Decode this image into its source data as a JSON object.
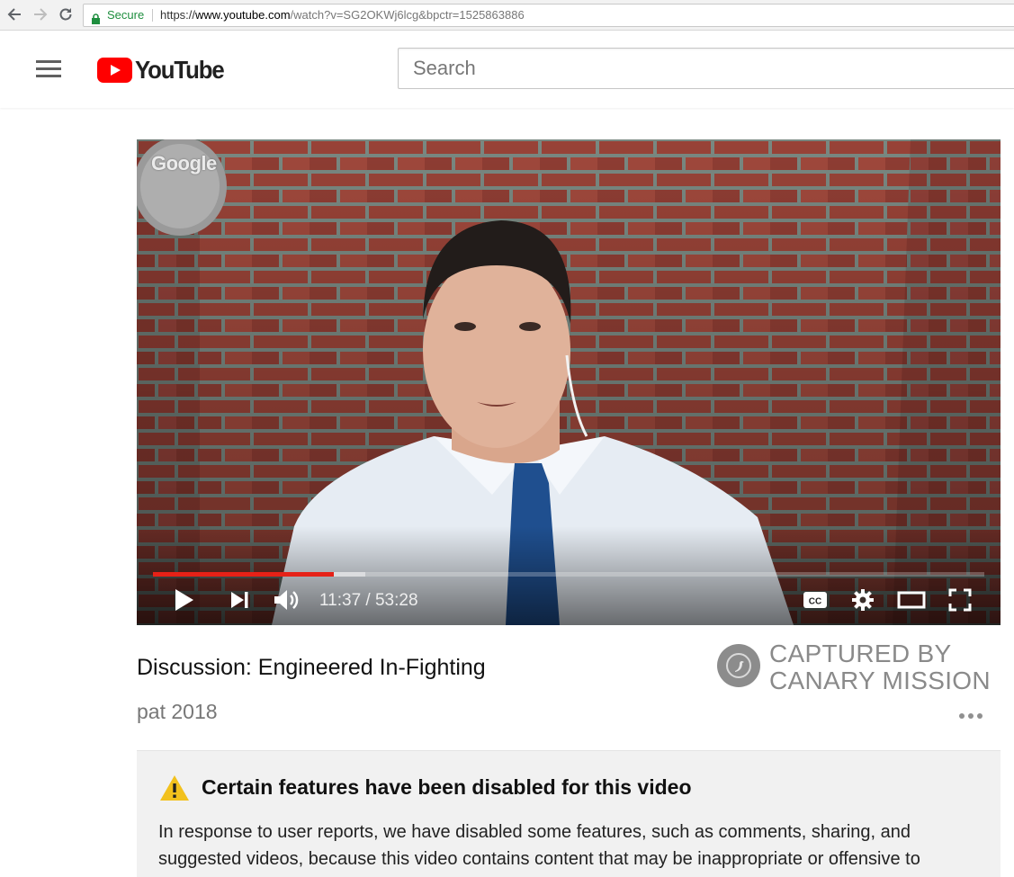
{
  "browser": {
    "secure_label": "Secure",
    "url_scheme": "https://",
    "url_host": "www.youtube.com",
    "url_path": "/watch?v=SG2OKWj6lcg&bpctr=1525863886"
  },
  "masthead": {
    "logo_text": "YouTube",
    "search_placeholder": "Search"
  },
  "player": {
    "watermark": "Google",
    "current_time": "11:37",
    "duration": "53:28",
    "time_separator": " / ",
    "played_fraction": 0.217,
    "buffered_fraction": 0.255,
    "progress_color": "#e62117"
  },
  "video": {
    "title": "Discussion: Engineered In-Fighting",
    "channel": "pat 2018"
  },
  "stamp": {
    "line1": "CAPTURED BY",
    "line2": "CANARY MISSION"
  },
  "notice": {
    "title": "Certain features have been disabled for this video",
    "body": "In response to user reports, we have disabled some features, such as comments, sharing, and suggested videos, because this video contains content that may be inappropriate or offensive to"
  },
  "icons": {
    "back": "back-arrow-icon",
    "forward": "forward-arrow-icon",
    "reload": "reload-icon",
    "lock": "lock-icon",
    "menu": "hamburger-menu-icon",
    "play": "play-icon",
    "next": "next-icon",
    "volume": "volume-icon",
    "cc": "closed-captions-icon",
    "settings": "gear-icon",
    "theater": "theater-mode-icon",
    "fullscreen": "fullscreen-icon",
    "warning": "warning-icon",
    "more": "more-actions-icon"
  }
}
